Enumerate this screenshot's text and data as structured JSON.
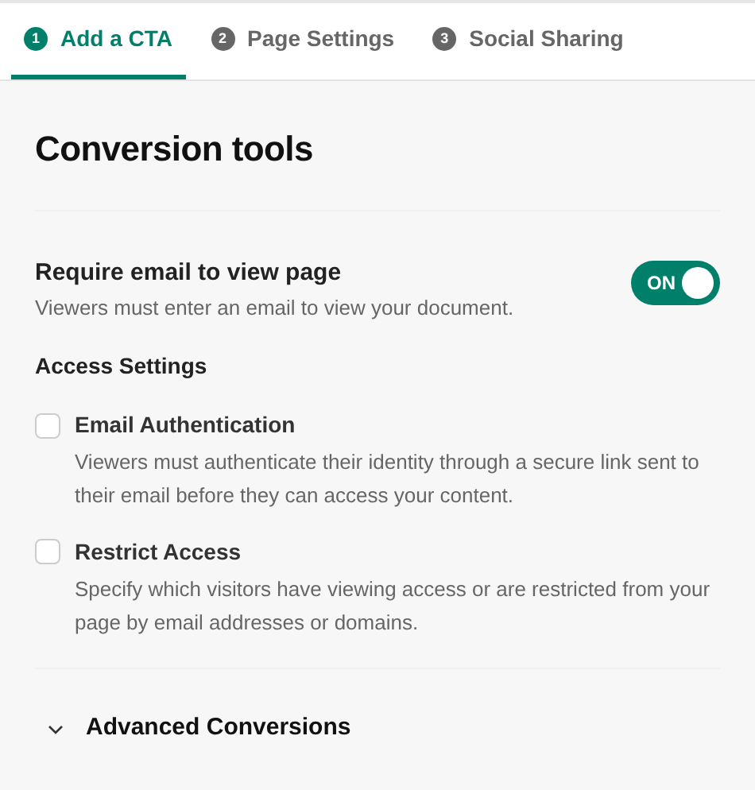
{
  "tabs": [
    {
      "number": "1",
      "label": "Add a CTA",
      "selected": true
    },
    {
      "number": "2",
      "label": "Page Settings",
      "selected": false
    },
    {
      "number": "3",
      "label": "Social Sharing",
      "selected": false
    }
  ],
  "title": "Conversion tools",
  "require_email": {
    "label": "Require email to view page",
    "description": "Viewers must enter an email to view your document.",
    "on": true,
    "toggle_text": "ON"
  },
  "access_settings": {
    "heading": "Access Settings",
    "options": [
      {
        "label": "Email Authentication",
        "description": "Viewers must authenticate their identity through a secure link sent to their email before they can access your content.",
        "checked": false
      },
      {
        "label": "Restrict Access",
        "description": "Specify which visitors have viewing access or are restricted from your page by email addresses or domains.",
        "checked": false
      }
    ]
  },
  "advanced": {
    "label": "Advanced Conversions",
    "expanded": false
  }
}
